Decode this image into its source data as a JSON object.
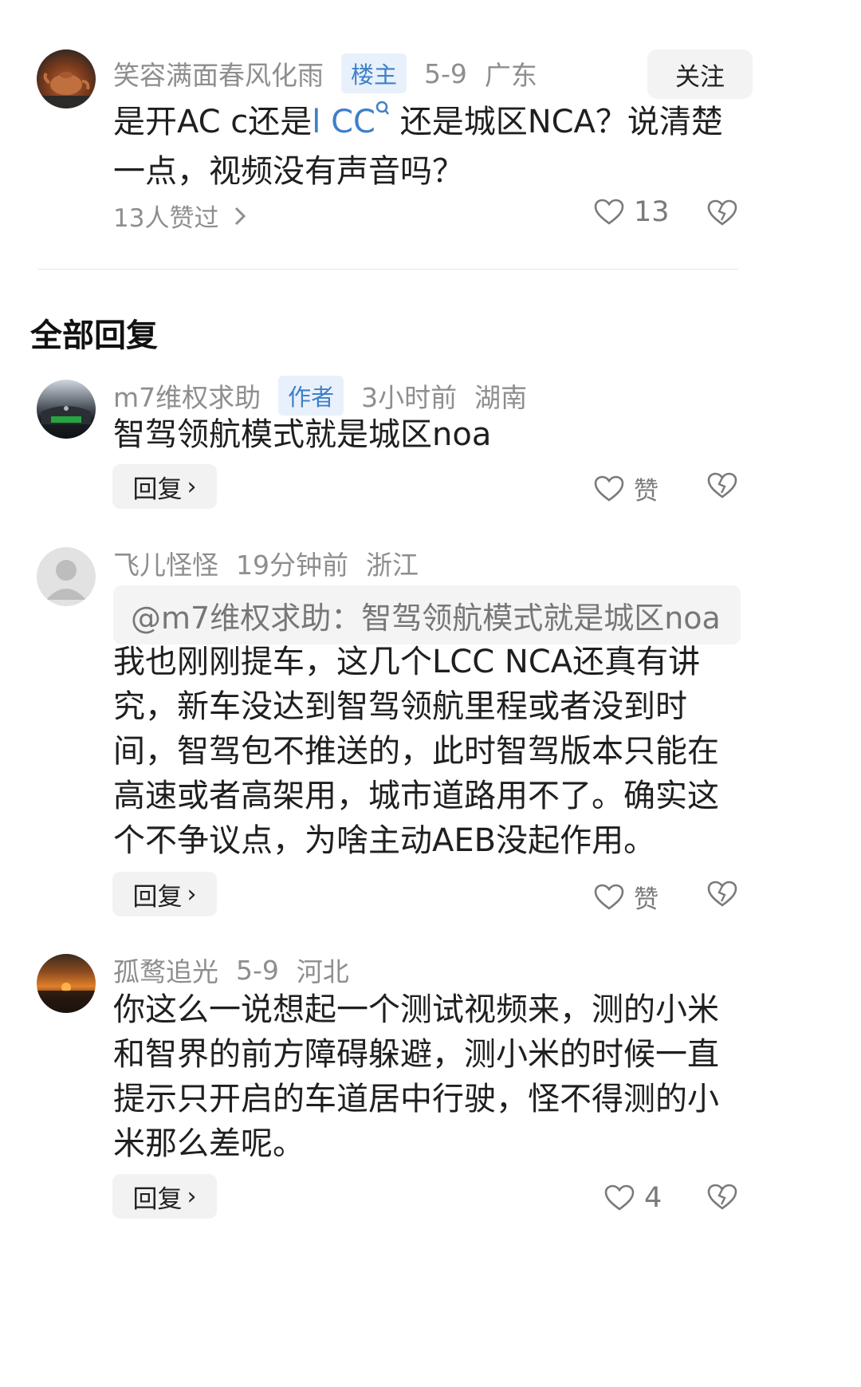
{
  "op": {
    "username": "笑容满面春风化雨",
    "badge": "楼主",
    "date": "5-9",
    "region": "广东",
    "follow_label": "关注",
    "content_part1": "是开AC c还是",
    "content_link": "l CC",
    "content_part2": " 还是城区NCA？说清楚一点，视频没有声音吗？",
    "likers_text": "13人赞过",
    "like_count": "13"
  },
  "section_title": "全部回复",
  "replies": [
    {
      "username": "m7维权求助",
      "badge": "作者",
      "time": "3小时前",
      "region": "湖南",
      "content": "智驾领航模式就是城区noa",
      "reply_label": "回复",
      "like_label": "赞"
    },
    {
      "username": "飞儿怪怪",
      "time": "19分钟前",
      "region": "浙江",
      "quote": "@m7维权求助：智驾领航模式就是城区noa",
      "content": "我也刚刚提车，这几个LCC NCA还真有讲究，新车没达到智驾领航里程或者没到时间，智驾包不推送的，此时智驾版本只能在高速或者高架用，城市道路用不了。确实这个不争议点，为啥主动AEB没起作用。",
      "reply_label": "回复",
      "like_label": "赞"
    },
    {
      "username": "孤鹜追光",
      "time": "5-9",
      "region": "河北",
      "content": "你这么一说想起一个测试视频来，测的小米和智界的前方障碍躲避，测小米的时候一直提示只开启的车道居中行驶，怪不得测的小米那么差呢。",
      "reply_label": "回复",
      "like_count": "4"
    }
  ],
  "colors": {
    "badge_bg": "#e8f1fb",
    "badge_text": "#3f7fc9",
    "link": "#3f7fc9",
    "meta": "#8e8e8e"
  },
  "icons": [
    "heart-outline-icon",
    "broken-heart-icon",
    "chevron-right-icon",
    "search-mini-icon",
    "avatar-placeholder-icon"
  ]
}
